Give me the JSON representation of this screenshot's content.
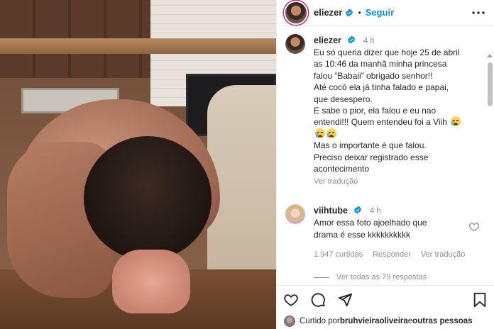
{
  "header": {
    "username": "eliezer",
    "separator": "•",
    "follow_label": "Seguir",
    "more_icon": "more-horizontal-icon"
  },
  "caption": {
    "username": "eliezer",
    "time": "4 h",
    "lines": [
      "Eu só queria dizer que hoje 25 de abril",
      "as 10:46 da manhã minha princesa",
      "falou “Babaii” obrigado senhor!!",
      "Até cocô ela já tinha falado e papai,",
      "que desespero.",
      "E sabe o pior, ela falou e eu nao",
      "entendi!!! Quem entendeu foi a Viih",
      "",
      "Mas o importante é que falou.",
      "Preciso deixar registrado esse",
      "acontecimento"
    ],
    "translate_label": "Ver tradução"
  },
  "comment": {
    "username": "viihtube",
    "time": "4 h",
    "lines": [
      "Amor essa foto ajoelhado que",
      "drama é esse kkkkkkkkkk"
    ],
    "likes_label": "1.947 curtidas",
    "reply_label": "Responder",
    "translate_label": "Ver tradução"
  },
  "replies_label": "Ver todas as 79 respostas",
  "likes": {
    "prefix": "Curtido por ",
    "user": "bruhvieiraoliveira",
    "middle": " e ",
    "others": "outras pessoas"
  },
  "colors": {
    "accent": "#0095f6",
    "verified": "#0095f6",
    "muted": "#8e8e8e",
    "text": "#262626"
  }
}
